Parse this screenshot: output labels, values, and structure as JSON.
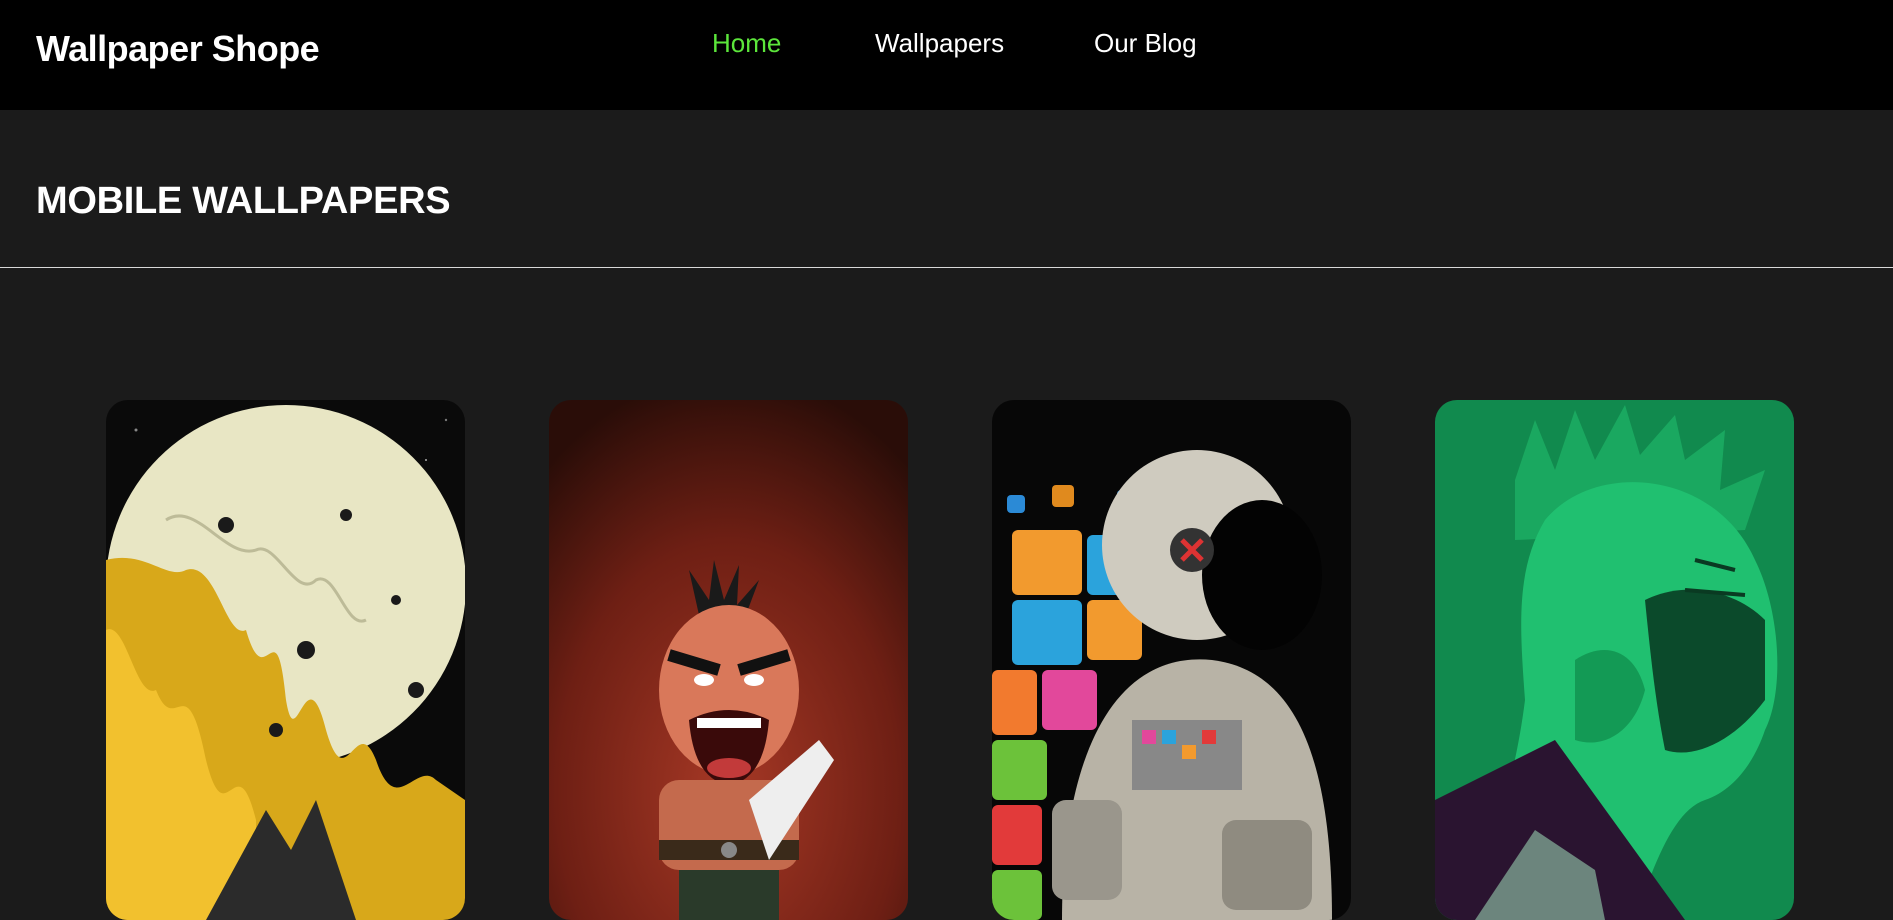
{
  "header": {
    "brand": "Wallpaper Shope",
    "nav": [
      {
        "label": "Home",
        "active": true
      },
      {
        "label": "Wallpapers",
        "active": false
      },
      {
        "label": "Our Blog",
        "active": false
      }
    ],
    "accent_color": "#5ce63b"
  },
  "main": {
    "section_title": "MOBILE WALLPAPERS",
    "wallpapers": [
      {
        "subject": "melting moon with yellow drips"
      },
      {
        "subject": "angry cartoon character holding paper"
      },
      {
        "subject": "astronaut with colorful cubes"
      },
      {
        "subject": "green toned face portrait"
      }
    ]
  }
}
